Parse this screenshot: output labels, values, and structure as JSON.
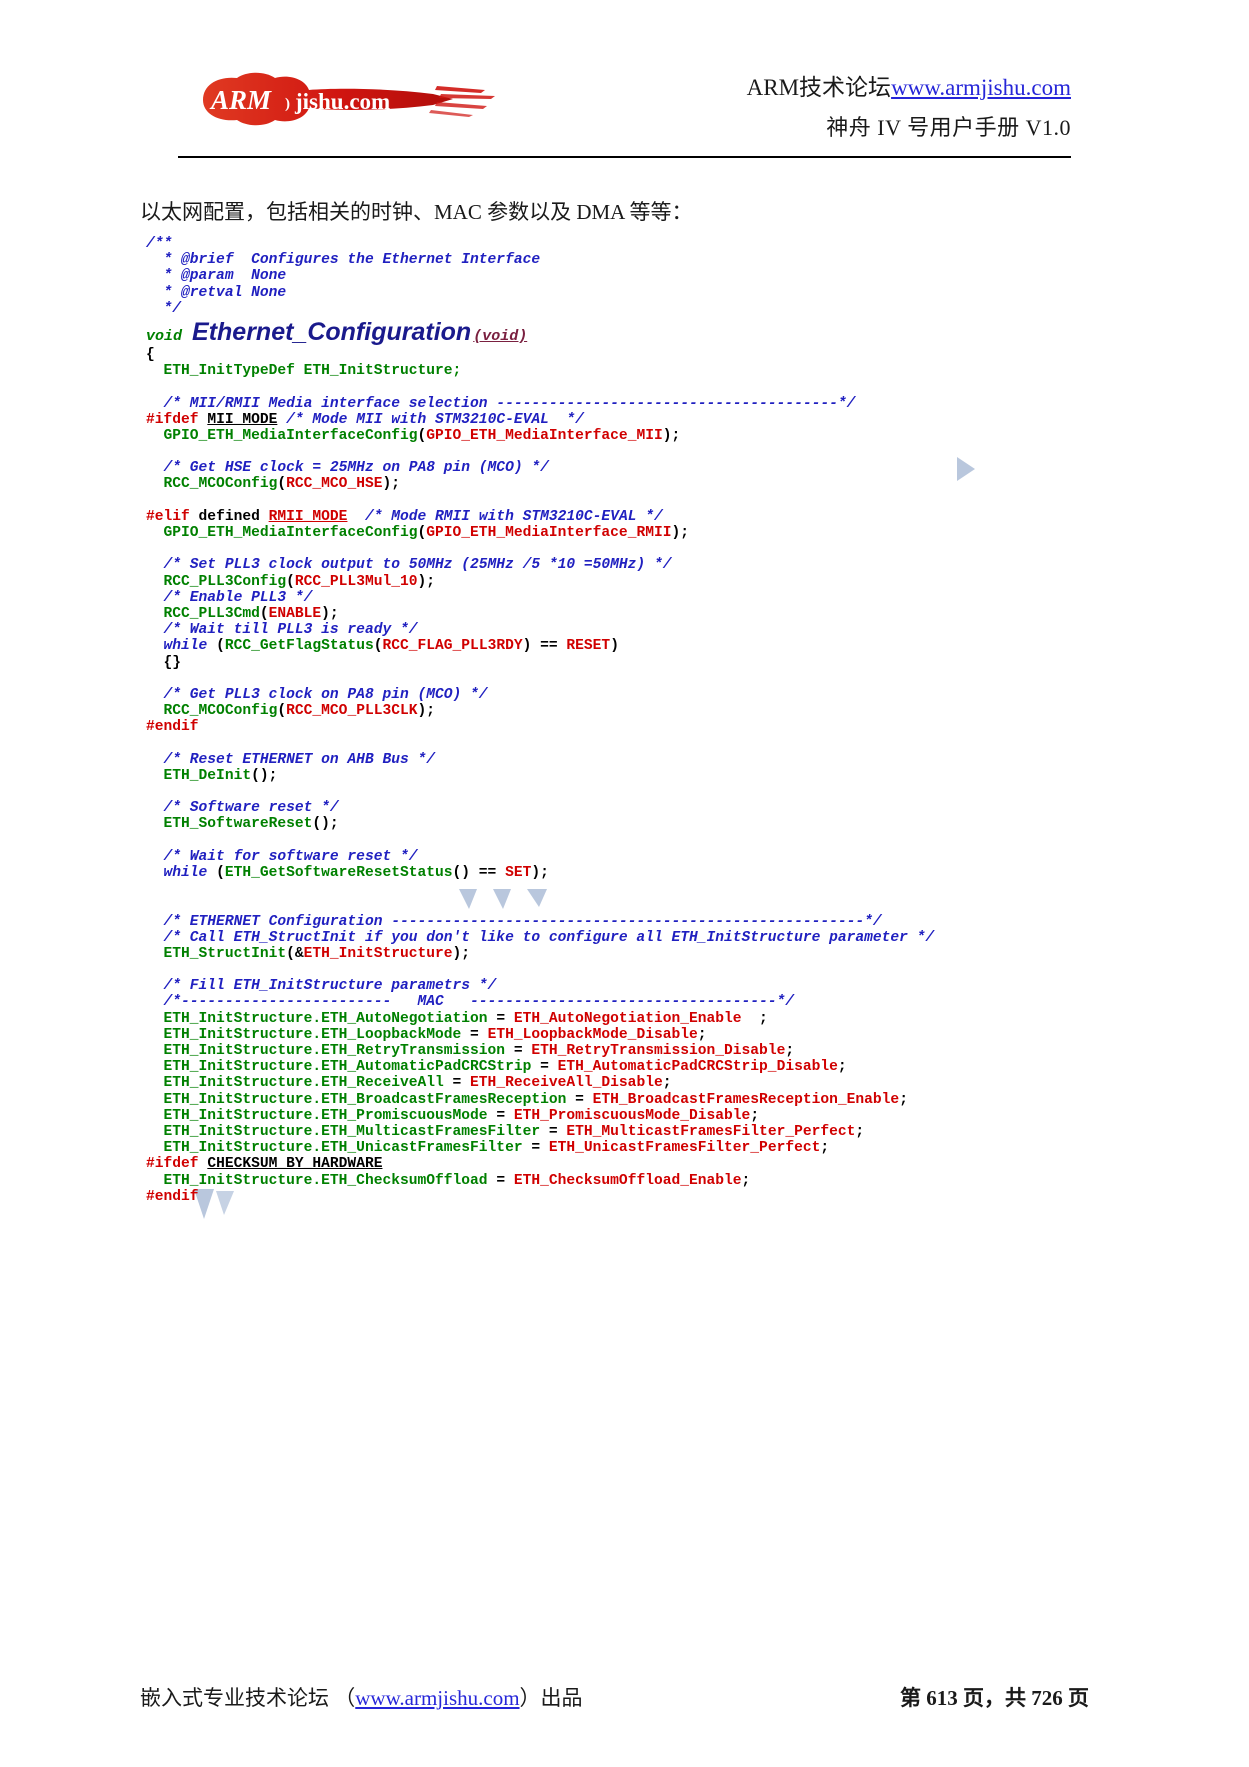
{
  "header": {
    "logo_alt": "ARMjishu.com",
    "logo_text_primary": "ARM",
    "logo_text_secondary": "jishu.com",
    "line1_prefix": "ARM技术论坛",
    "line1_url": "www.armjishu.com",
    "line2": "神舟 IV 号用户手册 V1.0"
  },
  "body": {
    "intro": "以太网配置，包括相关的时钟、MAC 参数以及 DMA 等等："
  },
  "code": {
    "signature": {
      "return_type": "void",
      "name": "Ethernet_Configuration",
      "params": "(void)"
    },
    "lines": [
      [
        {
          "t": "/**",
          "c": "c-comment"
        }
      ],
      [
        {
          "t": "  * @brief  Configures the Ethernet Interface",
          "c": "c-comment"
        }
      ],
      [
        {
          "t": "  * @param  None",
          "c": "c-comment"
        }
      ],
      [
        {
          "t": "  * @retval None",
          "c": "c-comment"
        }
      ],
      [
        {
          "t": "  */",
          "c": "c-comment"
        }
      ],
      [
        {
          "t": "__SIGNATURE__",
          "c": "sig"
        }
      ],
      [
        {
          "t": "{",
          "c": "c-plain"
        }
      ],
      [
        {
          "t": "  ",
          "c": "c-plain"
        },
        {
          "t": "ETH_InitTypeDef ETH_InitStructure;",
          "c": "c-type"
        }
      ],
      [
        {
          "t": "",
          "c": "c-plain"
        }
      ],
      [
        {
          "t": "  /* MII/RMII Media interface selection ---------------------------------------*/",
          "c": "c-comment"
        }
      ],
      [
        {
          "t": "#ifdef",
          "c": "c-pre"
        },
        {
          "t": " ",
          "c": "c-plain"
        },
        {
          "t": "MII_MODE",
          "c": "c-macro"
        },
        {
          "t": " ",
          "c": "c-plain"
        },
        {
          "t": "/* Mode MII with STM3210C-EVAL  */",
          "c": "c-comment"
        }
      ],
      [
        {
          "t": "  ",
          "c": "c-plain"
        },
        {
          "t": "GPIO_ETH_MediaInterfaceConfig",
          "c": "c-fn"
        },
        {
          "t": "(",
          "c": "c-plain"
        },
        {
          "t": "GPIO_ETH_MediaInterface_MII",
          "c": "c-arg"
        },
        {
          "t": ");",
          "c": "c-plain"
        }
      ],
      [
        {
          "t": "",
          "c": "c-plain"
        }
      ],
      [
        {
          "t": "  /* Get HSE clock = 25MHz on PA8 pin (MCO) */",
          "c": "c-comment"
        }
      ],
      [
        {
          "t": "  ",
          "c": "c-plain"
        },
        {
          "t": "RCC_MCOConfig",
          "c": "c-fn"
        },
        {
          "t": "(",
          "c": "c-plain"
        },
        {
          "t": "RCC_MCO_HSE",
          "c": "c-arg"
        },
        {
          "t": ");",
          "c": "c-plain"
        }
      ],
      [
        {
          "t": "",
          "c": "c-plain"
        }
      ],
      [
        {
          "t": "#elif",
          "c": "c-pre"
        },
        {
          "t": " defined ",
          "c": "c-kw"
        },
        {
          "t": "RMII_MODE",
          "c": "c-macro-red"
        },
        {
          "t": "  ",
          "c": "c-plain"
        },
        {
          "t": "/* Mode RMII with STM3210C-EVAL */",
          "c": "c-comment"
        }
      ],
      [
        {
          "t": "  ",
          "c": "c-plain"
        },
        {
          "t": "GPIO_ETH_MediaInterfaceConfig",
          "c": "c-fn"
        },
        {
          "t": "(",
          "c": "c-plain"
        },
        {
          "t": "GPIO_ETH_MediaInterface_RMII",
          "c": "c-arg"
        },
        {
          "t": ");",
          "c": "c-plain"
        }
      ],
      [
        {
          "t": "",
          "c": "c-plain"
        }
      ],
      [
        {
          "t": "  /* Set PLL3 clock output to 50MHz (25MHz /5 *10 =50MHz) */",
          "c": "c-comment"
        }
      ],
      [
        {
          "t": "  ",
          "c": "c-plain"
        },
        {
          "t": "RCC_PLL3Config",
          "c": "c-fn"
        },
        {
          "t": "(",
          "c": "c-plain"
        },
        {
          "t": "RCC_PLL3Mul_10",
          "c": "c-arg"
        },
        {
          "t": ");",
          "c": "c-plain"
        }
      ],
      [
        {
          "t": "  /* Enable PLL3 */",
          "c": "c-comment"
        }
      ],
      [
        {
          "t": "  ",
          "c": "c-plain"
        },
        {
          "t": "RCC_PLL3Cmd",
          "c": "c-fn"
        },
        {
          "t": "(",
          "c": "c-plain"
        },
        {
          "t": "ENABLE",
          "c": "c-arg"
        },
        {
          "t": ");",
          "c": "c-plain"
        }
      ],
      [
        {
          "t": "  /* Wait till PLL3 is ready */",
          "c": "c-comment"
        }
      ],
      [
        {
          "t": "  ",
          "c": "c-plain"
        },
        {
          "t": "while",
          "c": "c-comment"
        },
        {
          "t": " (",
          "c": "c-plain"
        },
        {
          "t": "RCC_GetFlagStatus",
          "c": "c-fn"
        },
        {
          "t": "(",
          "c": "c-plain"
        },
        {
          "t": "RCC_FLAG_PLL3RDY",
          "c": "c-arg"
        },
        {
          "t": ") == ",
          "c": "c-plain"
        },
        {
          "t": "RESET",
          "c": "c-arg"
        },
        {
          "t": ")",
          "c": "c-plain"
        }
      ],
      [
        {
          "t": "  {}",
          "c": "c-plain"
        }
      ],
      [
        {
          "t": "",
          "c": "c-plain"
        }
      ],
      [
        {
          "t": "  /* Get PLL3 clock on PA8 pin (MCO) */",
          "c": "c-comment"
        }
      ],
      [
        {
          "t": "  ",
          "c": "c-plain"
        },
        {
          "t": "RCC_MCOConfig",
          "c": "c-fn"
        },
        {
          "t": "(",
          "c": "c-plain"
        },
        {
          "t": "RCC_MCO_PLL3CLK",
          "c": "c-arg"
        },
        {
          "t": ");",
          "c": "c-plain"
        }
      ],
      [
        {
          "t": "#endif",
          "c": "c-pre"
        }
      ],
      [
        {
          "t": "",
          "c": "c-plain"
        }
      ],
      [
        {
          "t": "  /* Reset ETHERNET on AHB Bus */",
          "c": "c-comment"
        }
      ],
      [
        {
          "t": "  ",
          "c": "c-plain"
        },
        {
          "t": "ETH_DeInit",
          "c": "c-fn"
        },
        {
          "t": "();",
          "c": "c-plain"
        }
      ],
      [
        {
          "t": "",
          "c": "c-plain"
        }
      ],
      [
        {
          "t": "  /* Software reset */",
          "c": "c-comment"
        }
      ],
      [
        {
          "t": "  ",
          "c": "c-plain"
        },
        {
          "t": "ETH_SoftwareReset",
          "c": "c-fn"
        },
        {
          "t": "();",
          "c": "c-plain"
        }
      ],
      [
        {
          "t": "",
          "c": "c-plain"
        }
      ],
      [
        {
          "t": "  /* Wait for software reset */",
          "c": "c-comment"
        }
      ],
      [
        {
          "t": "  ",
          "c": "c-plain"
        },
        {
          "t": "while",
          "c": "c-comment"
        },
        {
          "t": " (",
          "c": "c-plain"
        },
        {
          "t": "ETH_GetSoftwareResetStatus",
          "c": "c-fn"
        },
        {
          "t": "() == ",
          "c": "c-plain"
        },
        {
          "t": "SET",
          "c": "c-arg"
        },
        {
          "t": ");",
          "c": "c-plain"
        }
      ],
      [
        {
          "t": "",
          "c": "c-plain"
        }
      ],
      [
        {
          "t": "",
          "c": "c-plain"
        }
      ],
      [
        {
          "t": "  /* ETHERNET Configuration ------------------------------------------------------*/",
          "c": "c-comment"
        }
      ],
      [
        {
          "t": "  /* Call ETH_StructInit if you don't like to configure all ETH_InitStructure parameter */",
          "c": "c-comment"
        }
      ],
      [
        {
          "t": "  ",
          "c": "c-plain"
        },
        {
          "t": "ETH_StructInit",
          "c": "c-fn"
        },
        {
          "t": "(&",
          "c": "c-plain"
        },
        {
          "t": "ETH_InitStructure",
          "c": "c-arg"
        },
        {
          "t": ");",
          "c": "c-plain"
        }
      ],
      [
        {
          "t": "",
          "c": "c-plain"
        }
      ],
      [
        {
          "t": "  /* Fill ETH_InitStructure parametrs */",
          "c": "c-comment"
        }
      ],
      [
        {
          "t": "  /*------------------------   MAC   -----------------------------------*/",
          "c": "c-comment"
        }
      ],
      [
        {
          "t": "  ",
          "c": "c-plain"
        },
        {
          "t": "ETH_InitStructure.ETH_AutoNegotiation",
          "c": "c-fn"
        },
        {
          "t": " = ",
          "c": "c-plain"
        },
        {
          "t": "ETH_AutoNegotiation_Enable",
          "c": "c-arg"
        },
        {
          "t": "  ;",
          "c": "c-plain"
        }
      ],
      [
        {
          "t": "  ",
          "c": "c-plain"
        },
        {
          "t": "ETH_InitStructure.ETH_LoopbackMode",
          "c": "c-fn"
        },
        {
          "t": " = ",
          "c": "c-plain"
        },
        {
          "t": "ETH_LoopbackMode_Disable",
          "c": "c-arg"
        },
        {
          "t": ";",
          "c": "c-plain"
        }
      ],
      [
        {
          "t": "  ",
          "c": "c-plain"
        },
        {
          "t": "ETH_InitStructure.ETH_RetryTransmission",
          "c": "c-fn"
        },
        {
          "t": " = ",
          "c": "c-plain"
        },
        {
          "t": "ETH_RetryTransmission_Disable",
          "c": "c-arg"
        },
        {
          "t": ";",
          "c": "c-plain"
        }
      ],
      [
        {
          "t": "  ",
          "c": "c-plain"
        },
        {
          "t": "ETH_InitStructure.ETH_AutomaticPadCRCStrip",
          "c": "c-fn"
        },
        {
          "t": " = ",
          "c": "c-plain"
        },
        {
          "t": "ETH_AutomaticPadCRCStrip_Disable",
          "c": "c-arg"
        },
        {
          "t": ";",
          "c": "c-plain"
        }
      ],
      [
        {
          "t": "  ",
          "c": "c-plain"
        },
        {
          "t": "ETH_InitStructure.ETH_ReceiveAll",
          "c": "c-fn"
        },
        {
          "t": " = ",
          "c": "c-plain"
        },
        {
          "t": "ETH_ReceiveAll_Disable",
          "c": "c-arg"
        },
        {
          "t": ";",
          "c": "c-plain"
        }
      ],
      [
        {
          "t": "  ",
          "c": "c-plain"
        },
        {
          "t": "ETH_InitStructure.ETH_BroadcastFramesReception",
          "c": "c-fn"
        },
        {
          "t": " = ",
          "c": "c-plain"
        },
        {
          "t": "ETH_BroadcastFramesReception_Enable",
          "c": "c-arg"
        },
        {
          "t": ";",
          "c": "c-plain"
        }
      ],
      [
        {
          "t": "  ",
          "c": "c-plain"
        },
        {
          "t": "ETH_InitStructure.ETH_PromiscuousMode",
          "c": "c-fn"
        },
        {
          "t": " = ",
          "c": "c-plain"
        },
        {
          "t": "ETH_PromiscuousMode_Disable",
          "c": "c-arg"
        },
        {
          "t": ";",
          "c": "c-plain"
        }
      ],
      [
        {
          "t": "  ",
          "c": "c-plain"
        },
        {
          "t": "ETH_InitStructure.ETH_MulticastFramesFilter",
          "c": "c-fn"
        },
        {
          "t": " = ",
          "c": "c-plain"
        },
        {
          "t": "ETH_MulticastFramesFilter_Perfect",
          "c": "c-arg"
        },
        {
          "t": ";",
          "c": "c-plain"
        }
      ],
      [
        {
          "t": "  ",
          "c": "c-plain"
        },
        {
          "t": "ETH_InitStructure.ETH_UnicastFramesFilter",
          "c": "c-fn"
        },
        {
          "t": " = ",
          "c": "c-plain"
        },
        {
          "t": "ETH_UnicastFramesFilter_Perfect",
          "c": "c-arg"
        },
        {
          "t": ";",
          "c": "c-plain"
        }
      ],
      [
        {
          "t": "#ifdef",
          "c": "c-pre"
        },
        {
          "t": " ",
          "c": "c-plain"
        },
        {
          "t": "CHECKSUM_BY_HARDWARE",
          "c": "c-macro"
        }
      ],
      [
        {
          "t": "  ",
          "c": "c-plain"
        },
        {
          "t": "ETH_InitStructure.ETH_ChecksumOffload",
          "c": "c-fn"
        },
        {
          "t": " = ",
          "c": "c-plain"
        },
        {
          "t": "ETH_ChecksumOffload_Enable",
          "c": "c-arg"
        },
        {
          "t": ";",
          "c": "c-plain"
        }
      ],
      [
        {
          "t": "#endif",
          "c": "c-pre"
        }
      ]
    ]
  },
  "footer": {
    "left_prefix": "嵌入式专业技术论坛 （",
    "left_url": "www.armjishu.com",
    "left_suffix": "）出品",
    "right": "第 613 页，共 726 页"
  },
  "colors": {
    "comment": "#2020c0",
    "preprocessor": "#d00000",
    "type": "#008000",
    "argument": "#d00000",
    "link": "#2626d8",
    "logo_red": "#d91f16",
    "signature": "#1a1a8c"
  }
}
